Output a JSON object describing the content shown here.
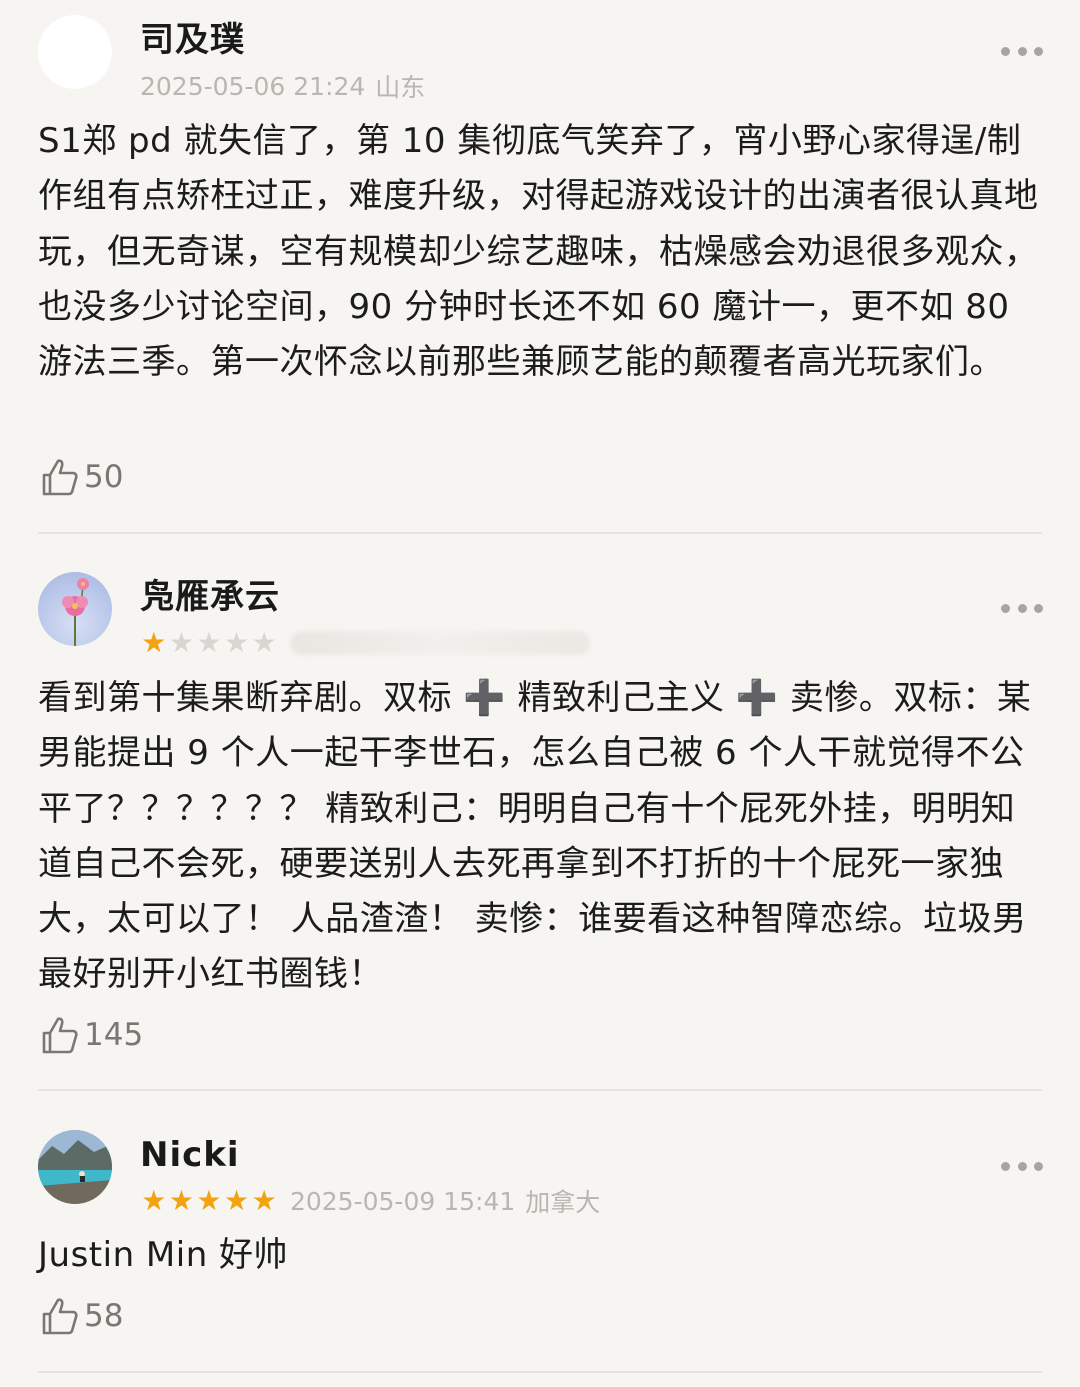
{
  "reviews": [
    {
      "user": "司及璞",
      "date": "2025-05-06 21:24",
      "location": "山东",
      "rating": null,
      "text": "S1郑 pd 就失信了，第 10 集彻底气笑弃了，宵小野心家得逞/制作组有点矫枉过正，难度升级，对得起游戏设计的出演者很认真地玩，但无奇谋，空有规模却少综艺趣味，枯燥感会劝退很多观众，也没多少讨论空间，90 分钟时长还不如 60 魔计一，更不如 80 游法三季。第一次怀念以前那些兼顾艺能的颠覆者高光玩家们。",
      "likes": "50"
    },
    {
      "user": "凫雁承云",
      "date": "",
      "location": "",
      "rating": 1,
      "text": "看到第十集果断弃剧。双标 ➕ 精致利己主义 ➕ 卖惨。双标：某男能提出 9 个人一起干李世石，怎么自己被 6 个人干就觉得不公平了？？？？？？ 精致利己：明明自己有十个屁死外挂，明明知道自己不会死，硬要送别人去死再拿到不打折的十个屁死一家独大，太可以了！ 人品渣渣！ 卖惨：谁要看这种智障恋综。垃圾男最好别开小红书圈钱！",
      "likes": "145"
    },
    {
      "user": "Nicki",
      "date": "2025-05-09 15:41",
      "location": "加拿大",
      "rating": 5,
      "text": "Justin Min 好帅",
      "likes": "58"
    }
  ],
  "icons": {
    "more": "more-dots-icon",
    "like": "thumbs-up-icon",
    "star": "star-icon"
  },
  "colors": {
    "background": "#f7f5f2",
    "star_active": "#f2a30f",
    "star_inactive": "#d9d6d2",
    "meta_text": "#b9b6b2"
  }
}
